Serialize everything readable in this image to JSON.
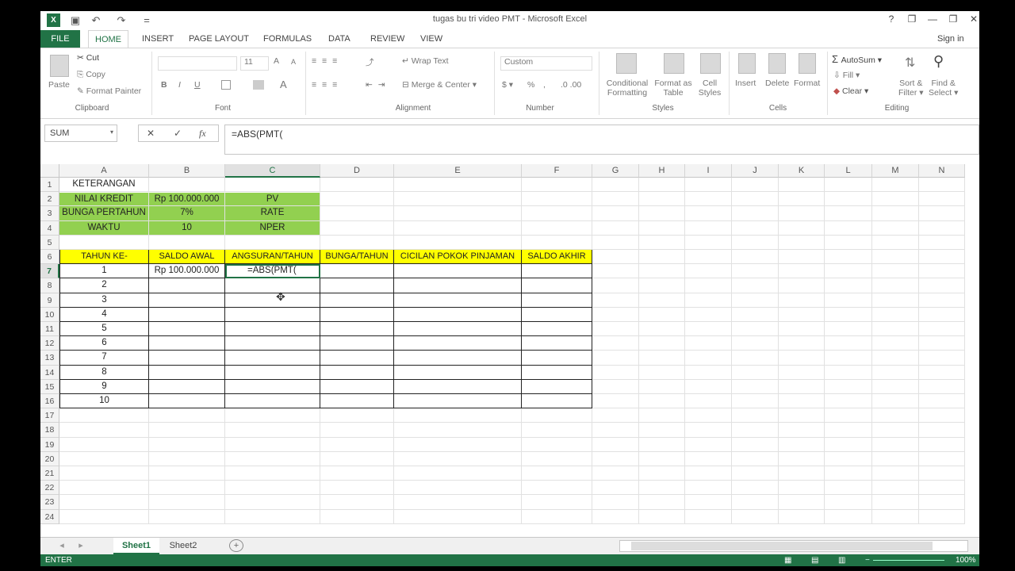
{
  "window": {
    "title": "tugas bu tri video PMT - Microsoft Excel",
    "help": "?",
    "minimize": "—",
    "restore": "❐",
    "close": "✕"
  },
  "qat": {
    "save_icon": "save-icon",
    "undo_icon": "undo-icon",
    "redo_icon": "redo-icon",
    "more": "="
  },
  "ribbon_tabs": {
    "file": "FILE",
    "home": "HOME",
    "insert": "INSERT",
    "page_layout": "PAGE LAYOUT",
    "formulas": "FORMULAS",
    "data": "DATA",
    "review": "REVIEW",
    "view": "VIEW",
    "sign_in": "Sign in"
  },
  "ribbon": {
    "clipboard": {
      "paste": "Paste",
      "cut": "Cut",
      "copy": "Copy",
      "format_painter": "Format Painter",
      "label": "Clipboard"
    },
    "font": {
      "font_size": "11",
      "bold": "B",
      "italic": "I",
      "underline": "U",
      "grow": "A",
      "shrink": "A",
      "font_color": "A",
      "label": "Font"
    },
    "alignment": {
      "wrap_text": "Wrap Text",
      "merge_center": "Merge & Center",
      "label": "Alignment"
    },
    "number": {
      "format": "Custom",
      "percent": "%",
      "comma": ",",
      "label": "Number"
    },
    "styles": {
      "conditional": "Conditional",
      "conditional2": "Formatting",
      "format_as": "Format as",
      "table": "Table",
      "cell": "Cell",
      "styles": "Styles",
      "label": "Styles"
    },
    "cells": {
      "insert": "Insert",
      "delete": "Delete",
      "format": "Format",
      "label": "Cells"
    },
    "editing": {
      "autosum": "AutoSum",
      "fill": "Fill",
      "clear": "Clear",
      "sort": "Sort &",
      "filter": "Filter",
      "find": "Find &",
      "select": "Select",
      "label": "Editing"
    }
  },
  "formula_bar": {
    "name_box": "SUM",
    "cancel": "✕",
    "enter": "✓",
    "fx": "fx",
    "content": "=ABS(PMT("
  },
  "columns": [
    "A",
    "B",
    "C",
    "D",
    "E",
    "F",
    "G",
    "H",
    "I",
    "J",
    "K",
    "L",
    "M",
    "N"
  ],
  "rows": [
    "1",
    "2",
    "3",
    "4",
    "5",
    "6",
    "7",
    "8",
    "9",
    "10",
    "11",
    "12",
    "13",
    "14",
    "15",
    "16",
    "17",
    "18",
    "19",
    "20",
    "21",
    "22",
    "23",
    "24"
  ],
  "cells": {
    "A1": "KETERANGAN",
    "A2": "NILAI KREDIT",
    "B2": "Rp 100.000.000",
    "C2": "PV",
    "A3": "BUNGA PERTAHUN",
    "B3": "7%",
    "C3": "RATE",
    "A4": "WAKTU",
    "B4": "10",
    "C4": "NPER",
    "A6": "TAHUN KE-",
    "B6": "SALDO AWAL",
    "C6": "ANGSURAN/TAHUN",
    "D6": "BUNGA/TAHUN",
    "E6": "CICILAN POKOK PINJAMAN",
    "F6": "SALDO AKHIR",
    "A7": "1",
    "B7": "Rp 100.000.000",
    "C7": "=ABS(PMT(",
    "A8": "2",
    "A9": "3",
    "A10": "4",
    "A11": "5",
    "A12": "6",
    "A13": "7",
    "A14": "8",
    "A15": "9",
    "A16": "10"
  },
  "sheets": {
    "sheet1": "Sheet1",
    "sheet2": "Sheet2",
    "add": "+"
  },
  "status": {
    "mode": "ENTER",
    "zoom": "100%"
  },
  "colors": {
    "excel_green": "#217346",
    "fill_green": "#92d050",
    "fill_yellow": "#ffff00"
  }
}
